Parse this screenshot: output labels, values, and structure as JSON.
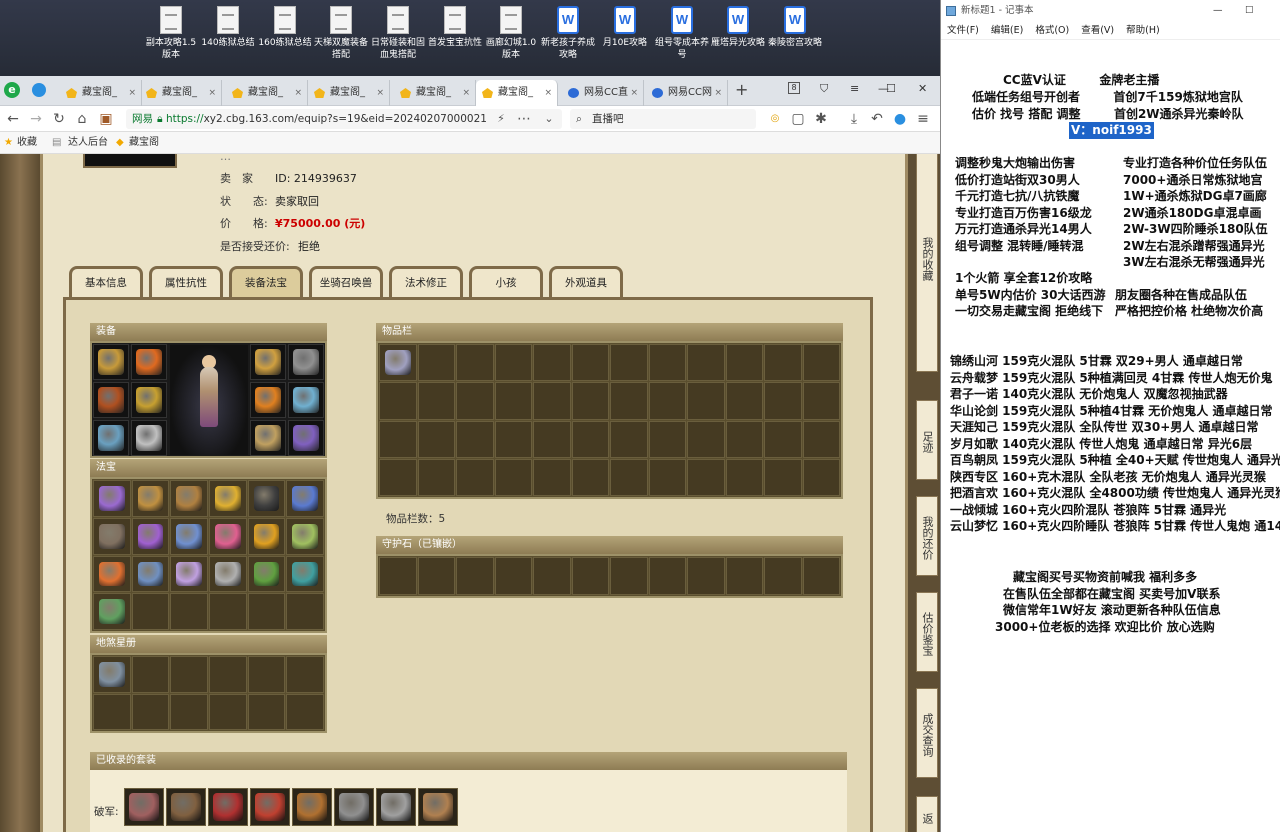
{
  "desktop_icons": [
    {
      "label": "副本攻略1.5版本",
      "type": "doc"
    },
    {
      "label": "140练狱总结",
      "type": "doc"
    },
    {
      "label": "160练狱总结",
      "type": "doc"
    },
    {
      "label": "天梯双魔装备搭配",
      "type": "doc"
    },
    {
      "label": "日常碰装和固血鬼搭配",
      "type": "doc"
    },
    {
      "label": "首发宝宝抗性",
      "type": "doc"
    },
    {
      "label": "画廊幻城1.0版本",
      "type": "doc"
    },
    {
      "label": "新老孩子养成攻略",
      "type": "wps"
    },
    {
      "label": "月10E攻略",
      "type": "wps"
    },
    {
      "label": "组号零成本养号",
      "type": "wps"
    },
    {
      "label": "雁塔异光攻略",
      "type": "wps"
    },
    {
      "label": "秦陵密宫攻略",
      "type": "wps"
    }
  ],
  "browser": {
    "tabs": [
      "藏宝阁_",
      "藏宝阁_",
      "藏宝阁_",
      "藏宝阁_",
      "藏宝阁_",
      "藏宝阁_",
      "网易CC直",
      "网易CC网"
    ],
    "tab_close": "×",
    "new_tab": "+",
    "url_scheme": "https://",
    "url_rest": "xy2.cbg.163.com/equip?s=19&eid=20240207000021",
    "site_label": "网易",
    "search_placeholder": "直播吧",
    "bookmarks": [
      "收藏",
      "达人后台",
      "藏宝阁"
    ]
  },
  "listing": {
    "seller_label": "卖　家",
    "seller_value": "ID:  214939637",
    "status_label": "状　　态:",
    "status_value": "卖家取回",
    "price_label": "价　　格:",
    "price_value": "¥75000.00 (元)",
    "counter_label": "是否接受还价:",
    "counter_value": "拒绝",
    "partial_top": "…"
  },
  "game_tabs": [
    "基本信息",
    "属性抗性",
    "装备法宝",
    "坐骑召唤兽",
    "法术修正",
    "小孩",
    "外观道具"
  ],
  "active_game_tab": 2,
  "panels": {
    "equip": "装备",
    "fabao": "法宝",
    "dishaxing": "地煞星册",
    "inventory": "物品栏",
    "inventory_count": "物品栏数：5",
    "guardian": "守护石（已镶嵌）",
    "suits": "已收录的套装",
    "suit_row": "破军:"
  },
  "right_tabs": [
    "我的收藏",
    "足迹",
    "我的还价",
    "估价鉴宝",
    "成交查询",
    "返"
  ],
  "notepad": {
    "title": "新标题1 - 记事本",
    "menu": [
      "文件(F)",
      "编辑(E)",
      "格式(O)",
      "查看(V)",
      "帮助(H)"
    ],
    "header_lines": [
      "CC蓝V认证        金牌老主播",
      "低端任务组号开创者        首创7千159炼狱地宫队",
      "估价 找号 搭配 调整        首创2W通杀异光秦岭队"
    ],
    "contact": "V：noif1993",
    "block1": [
      [
        "调整秒鬼大炮输出伤害",
        "专业打造各种价位任务队伍"
      ],
      [
        "低价打造站街双30男人",
        "7000+通杀日常炼狱地宫"
      ],
      [
        "千元打造七抗/八抗铁魔",
        "1W+通杀炼狱DG卓7画廊"
      ],
      [
        "专业打造百万伤害16级龙",
        "2W通杀180DG卓混卓画"
      ],
      [
        "万元打造通杀异光14男人",
        "2W-3W四阶睡杀180队伍"
      ],
      [
        "组号调整 混转睡/睡转混",
        "2W左右混杀蹭帮强通异光"
      ],
      [
        "",
        "3W左右混杀无帮强通异光"
      ]
    ],
    "block2": [
      [
        "1个火箭 享全套12价攻略",
        ""
      ],
      [
        "单号5W内估价 30大话西游",
        "朋友圈各种在售成品队伍"
      ],
      [
        "一切交易走藏宝阁 拒绝线下",
        "严格把控价格 杜绝物次价高"
      ]
    ],
    "teams": [
      "锦绣山河 159克火混队 5甘霖 双29+男人 通卓越日常",
      "云舟载梦 159克火混队 5种植满回灵 4甘霖 传世人炮无价鬼",
      "君子一诺 140克火混队 无价炮鬼人 双魔忽视抽武器",
      "华山论剑 159克火混队 5种植4甘霖 无价炮鬼人 通卓越日常",
      "天涯知己 159克火混队 全队传世 双30+男人 通卓越日常",
      "岁月如歌 140克火混队 传世人炮鬼 通卓越日常 异光6层",
      "百鸟朝凤 159克火混队 5种植 全40+天赋 传世炮鬼人 通异光",
      "陕西专区 160+克木混队 全队老孩 无价炮鬼人 通异光灵猴",
      "把酒言欢 160+克火混队 全4800功绩 传世炮鬼人 通异光灵猴",
      "一战倾城 160+克火四阶混队 苍狼阵 5甘霖 通异光",
      "云山梦忆 160+克火四阶睡队 苍狼阵 5甘霖 传世人鬼炮 通14"
    ],
    "footer": [
      "藏宝阁买号买物资前喊我 福利多多",
      "在售队伍全部都在藏宝阁 买卖号加V联系",
      "微信常年1W好友 滚动更新各种队伍信息",
      "3000+位老板的选择 欢迎比价 放心选购"
    ]
  },
  "colors": {
    "price": "#cc0000",
    "selection": "#1e64c8",
    "panel_bg": "#e2d8b6"
  }
}
